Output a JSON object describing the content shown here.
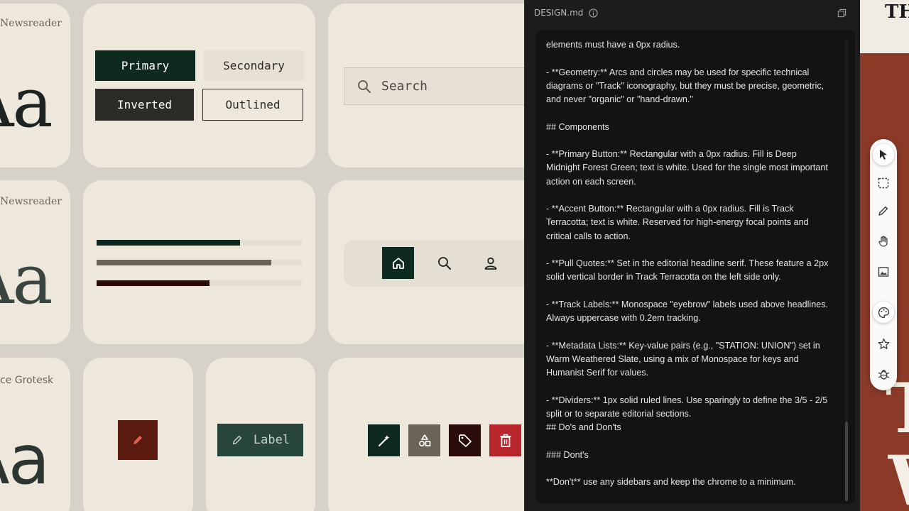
{
  "fonts": {
    "row1_name": "Newsreader",
    "row2_name": "Newsreader",
    "row3_name": "ce Grotesk",
    "specimen": "Aa"
  },
  "buttons": {
    "primary": "Primary",
    "secondary": "Secondary",
    "inverted": "Inverted",
    "outlined": "Outlined",
    "label": "Label"
  },
  "search": {
    "placeholder": "Search"
  },
  "progress_bars": [
    {
      "fill": 0.7,
      "color": "#0e2920"
    },
    {
      "fill": 0.85,
      "color": "#6b6355"
    },
    {
      "fill": 0.55,
      "color": "#2a0d0b"
    }
  ],
  "nav_icons": [
    "home-icon",
    "search-icon",
    "user-icon"
  ],
  "icon_buttons": [
    {
      "icon": "pencil-icon",
      "bg": "#5b1a10",
      "fg": "#e0604a"
    },
    {
      "icon": "magic-wand-icon",
      "bg": "#0e2920",
      "fg": "#ffffff"
    },
    {
      "icon": "shapes-icon",
      "bg": "#6b6355",
      "fg": "#ffffff"
    },
    {
      "icon": "tag-icon",
      "bg": "#2a0d0b",
      "fg": "#ffffff"
    },
    {
      "icon": "trash-icon",
      "bg": "#b8252b",
      "fg": "#ffffff"
    }
  ],
  "panel": {
    "title": "DESIGN.md",
    "lines": [
      "elements must have a 0px radius.",
      "- **Geometry:** Arcs and circles may be used for specific technical diagrams or \"Track\" iconography, but they must be precise, geometric, and never \"organic\" or \"hand-drawn.\"",
      "## Components",
      "- **Primary Button:** Rectangular with a 0px radius. Fill is Deep Midnight Forest Green; text is white. Used for the single most important action on each screen.",
      "- **Accent Button:** Rectangular with a 0px radius. Fill is Track Terracotta; text is white. Reserved for high-energy focal points and critical calls to action.",
      "- **Pull Quotes:** Set in the editorial headline serif. These feature a 2px solid vertical border in Track Terracotta on the left side only.",
      "- **Track Labels:** Monospace \"eyebrow\" labels used above headlines. Always uppercase with 0.2em tracking.",
      "- **Metadata Lists:** Key-value pairs (e.g., \"STATION: UNION\") set in Warm Weathered Slate, using a mix of Monospace for keys and Humanist Serif for values.",
      "- **Dividers:** 1px solid ruled lines. Use sparingly to define the 3/5 - 2/5 split or to separate editorial sections.",
      "## Do's and Don'ts",
      "### Dont's",
      "**Don't** use any sidebars and keep the chrome to a minimum."
    ]
  },
  "strip": {
    "top_text": "TH",
    "big1": "T",
    "big2": "W"
  },
  "tools": [
    "cursor-icon",
    "marquee-icon",
    "pen-icon",
    "hand-icon",
    "image-icon",
    "palette-icon",
    "star-icon",
    "bug-icon"
  ]
}
